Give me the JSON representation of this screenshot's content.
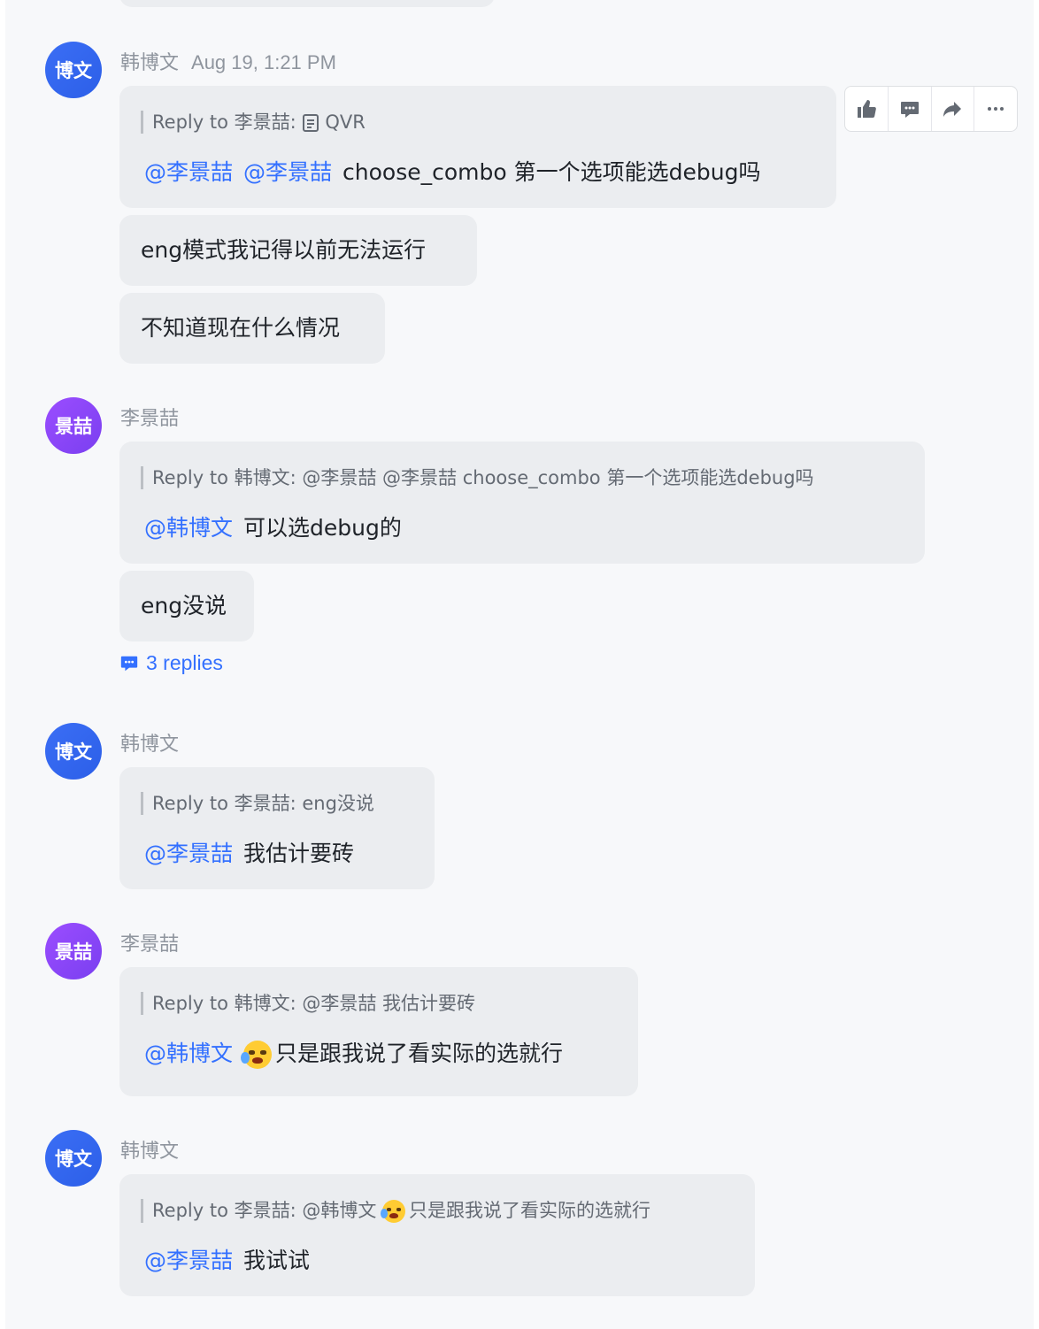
{
  "messages": [
    {
      "avatar": "博文",
      "name": "韩博文",
      "time": "Aug 19, 1:21 PM",
      "quote_prefix": "Reply to 李景喆:",
      "quote_text": "QVR",
      "mentions": [
        "@李景喆",
        "@李景喆"
      ],
      "text": "choose_combo 第一个选项能选debug吗",
      "extra": [
        "eng模式我记得以前无法运行",
        "不知道现在什么情况"
      ]
    },
    {
      "avatar": "景喆",
      "name": "李景喆",
      "quote_prefix": "Reply to 韩博文:",
      "quote_text": "@李景喆 @李景喆 choose_combo 第一个选项能选debug吗",
      "mention": "@韩博文",
      "text": "可以选debug的",
      "extra": [
        "eng没说"
      ],
      "replies": "3 replies"
    },
    {
      "avatar": "博文",
      "name": "韩博文",
      "quote_prefix": "Reply to 李景喆:",
      "quote_text": "eng没说",
      "mention": "@李景喆",
      "text": "我估计要砖"
    },
    {
      "avatar": "景喆",
      "name": "李景喆",
      "quote_prefix": "Reply to 韩博文:",
      "quote_text": "@李景喆 我估计要砖",
      "mention": "@韩博文",
      "text": "只是跟我说了看实际的选就行"
    },
    {
      "avatar": "博文",
      "name": "韩博文",
      "quote_prefix": "Reply to 李景喆:",
      "quote_text_a": "@韩博文",
      "quote_text_b": "只是跟我说了看实际的选就行",
      "mention": "@李景喆",
      "text": "我试试"
    }
  ],
  "toolbar": {
    "icons": [
      "thumbs-up-icon",
      "reply-thread-icon",
      "forward-icon",
      "more-icon"
    ]
  },
  "colors": {
    "mention": "#3370ff",
    "bubble": "#ebedf0",
    "avatar_blue": "#3b6ef5",
    "avatar_purple": "#8b45f8"
  }
}
